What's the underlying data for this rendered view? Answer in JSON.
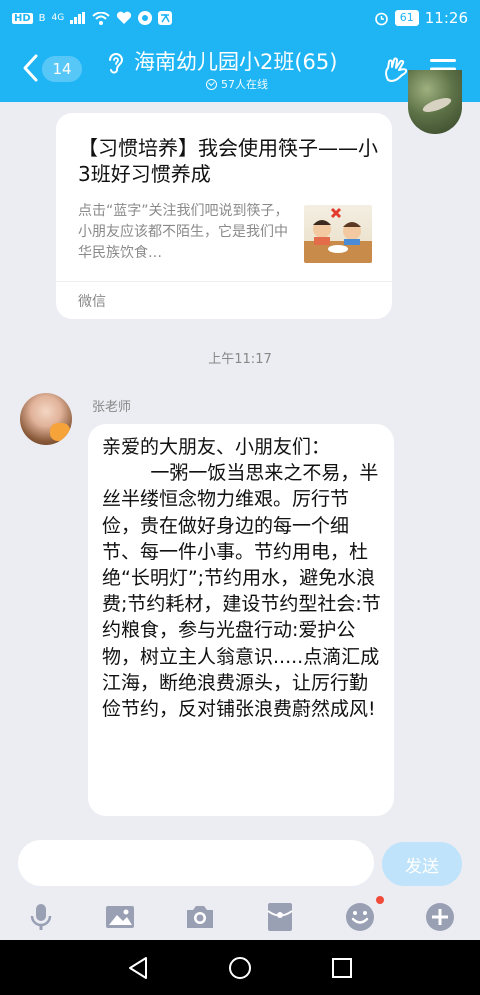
{
  "status_bar": {
    "left_badges": [
      "HD",
      "B"
    ],
    "network_label": "4G",
    "battery": "61",
    "time": "11:26"
  },
  "header": {
    "back_count": "14",
    "title": "海南幼儿园小2班(65)",
    "online_text": "57人在线",
    "accent_color": "#1fb5f5"
  },
  "card": {
    "title": "【习惯培养】我会使用筷子——小3班好习惯养成",
    "description": "点击“蓝字”关注我们吧说到筷子，小朋友应该都不陌生，它是我们中华民族饮食…",
    "source": "微信"
  },
  "time_separator": "上午11:17",
  "message": {
    "sender": "张老师",
    "text": "亲爱的大朋友、小朋友们：\n        一粥一饭当思来之不易，半丝半缕恒念物力维艰。厉行节俭，贵在做好身边的每一个细节、每一件小事。节约用电，杜绝“长明灯”;节约用水，避免水浪费;节约耗材，建设节约型社会:节约粮食，参与光盘行动:爱护公物，树立主人翁意识.....点滴汇成江海，断绝浪费源头，让厉行勤俭节约，反对铺张浪费蔚然成风!"
  },
  "input": {
    "placeholder": "",
    "send_label": "发送"
  },
  "toolbar": {
    "icons": [
      "mic-icon",
      "image-icon",
      "camera-icon",
      "red-packet-icon",
      "emoji-icon",
      "plus-icon"
    ]
  },
  "nav": {
    "icons": [
      "back-triangle-icon",
      "home-circle-icon",
      "recents-square-icon"
    ]
  }
}
